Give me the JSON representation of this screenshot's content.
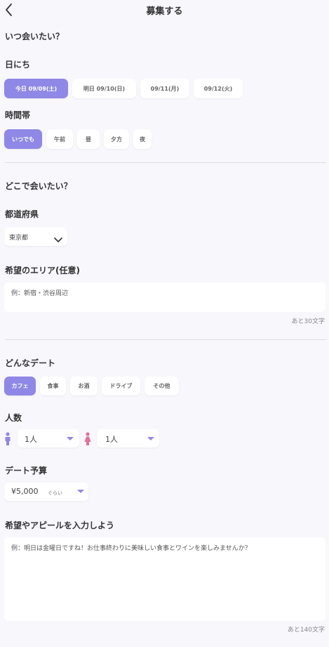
{
  "header": {
    "title": "募集する",
    "back_icon": "chevron-left-icon"
  },
  "when": {
    "heading": "いつ会いたい？",
    "date_label": "日にち",
    "dates": [
      "今日 09/09(土)",
      "明日 09/10(日)",
      "09/11(月)",
      "09/12(火)"
    ],
    "time_label": "時間帯",
    "times": [
      "いつでも",
      "午前",
      "昼",
      "夕方",
      "夜"
    ]
  },
  "where": {
    "heading": "どこで会いたい？",
    "pref_label": "都道府県",
    "pref_value": "東京都",
    "area_label": "希望のエリア(任意)",
    "area_placeholder": "例：新宿・渋谷周辺",
    "area_counter": "あと30文字"
  },
  "date_type": {
    "heading": "どんなデート",
    "types": [
      "カフェ",
      "食事",
      "お酒",
      "ドライブ",
      "その他"
    ]
  },
  "people": {
    "label": "人数",
    "male_count": "1人",
    "female_count": "1人"
  },
  "budget": {
    "label": "デート予算",
    "value": "¥5,000",
    "suffix": "ぐらい"
  },
  "appeal": {
    "label": "希望やアピールを入力しよう",
    "placeholder": "例：明日は金曜日ですね！お仕事終わりに美味しい食事とワインを楽しみませんか？",
    "counter": "あと140文字"
  },
  "colors": {
    "accent": "#8f88e6",
    "male": "#8f88e6",
    "female": "#e0709b"
  }
}
